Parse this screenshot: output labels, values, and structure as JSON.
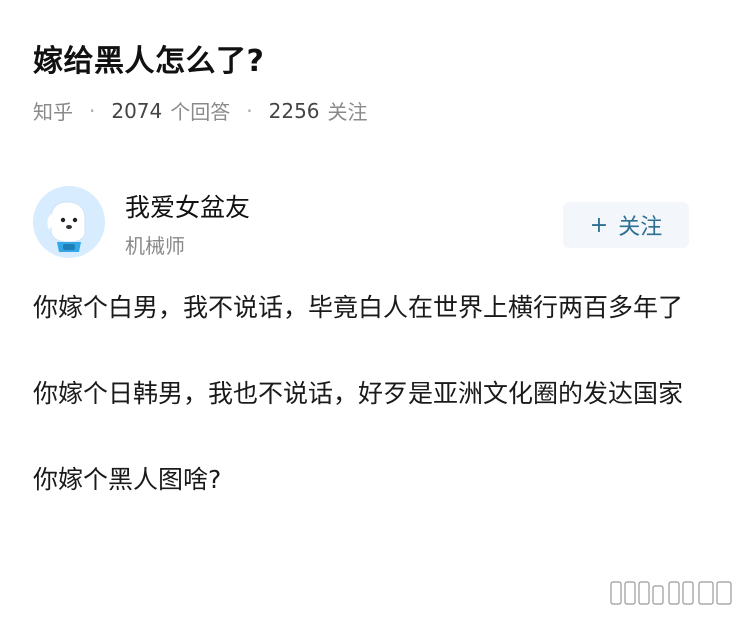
{
  "question": {
    "title": "嫁给黑人怎么了?"
  },
  "meta": {
    "source": "知乎",
    "answers_count": "2074",
    "answers_label": "个回答",
    "followers_count": "2256",
    "followers_label": "关注"
  },
  "author": {
    "name": "我爱女盆友",
    "title": "机械师",
    "follow_plus": "+",
    "follow_label": "关注"
  },
  "answer": {
    "paragraphs": [
      "你嫁个白男，我不说话，毕竟白人在世界上横行两百多年了",
      "你嫁个日韩男，我也不说话，好歹是亚洲文化圈的发达国家",
      "你嫁个黑人图啥?"
    ]
  },
  "colors": {
    "follow_text": "#2f6f92",
    "follow_bg": "#f3f7fb",
    "meta_gray": "#8a8a8a",
    "avatar_bg": "#dcefff"
  },
  "icons": {
    "avatar": "cartoon-dog-avatar-icon",
    "watermark": "watermark-icon"
  }
}
